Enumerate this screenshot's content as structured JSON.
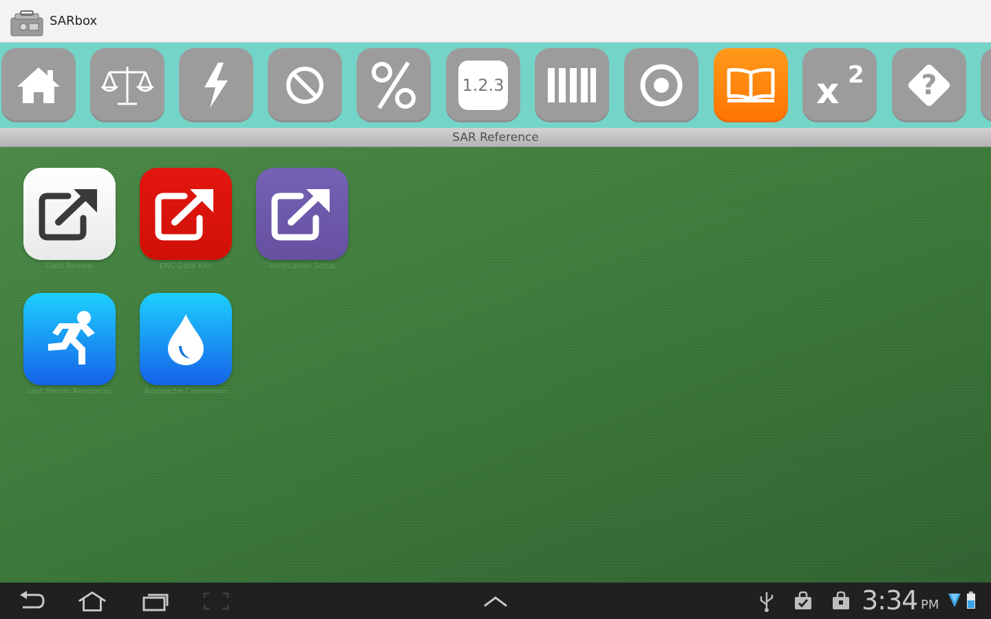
{
  "app": {
    "title": "SARbox",
    "logo_icon": "toolbox-icon"
  },
  "toolbar": {
    "items": [
      {
        "name": "home",
        "icon": "home-icon",
        "active": false
      },
      {
        "name": "balance",
        "icon": "balance-scale-icon",
        "active": false
      },
      {
        "name": "lightning",
        "icon": "lightning-icon",
        "active": false
      },
      {
        "name": "prohibited",
        "icon": "no-symbol-icon",
        "active": false
      },
      {
        "name": "percent",
        "icon": "percent-icon",
        "active": false
      },
      {
        "name": "numbers",
        "icon": "numbers-icon",
        "label": "1.2.3",
        "active": false
      },
      {
        "name": "bars",
        "icon": "bars-icon",
        "active": false
      },
      {
        "name": "target",
        "icon": "target-icon",
        "active": false
      },
      {
        "name": "reference",
        "icon": "book-icon",
        "active": true
      },
      {
        "name": "exponent",
        "icon": "x-squared-icon",
        "label": "x",
        "sup": "2",
        "active": false
      },
      {
        "name": "help",
        "icon": "question-diamond-icon",
        "label": "?",
        "active": false
      }
    ],
    "colors": {
      "background": "#74d4c8",
      "button": "#9c9c9c",
      "active": "#ff8a0d"
    }
  },
  "section": {
    "title": "SAR Reference"
  },
  "apps": [
    {
      "label": "Data Review",
      "icon": "external-link-icon",
      "color": "#ffffff"
    },
    {
      "label": "ENC Data Kits",
      "icon": "external-link-icon",
      "color": "#d8140e"
    },
    {
      "label": "Verification Setup",
      "icon": "external-link-icon",
      "color": "#6d57a8"
    },
    {
      "label": "Lost Person Resources",
      "icon": "running-person-icon",
      "color": "#1e8cf0"
    },
    {
      "label": "Avalanche Conversion",
      "icon": "water-drop-icon",
      "color": "#1e8cf0"
    }
  ],
  "statusbar": {
    "time": "3:34",
    "ampm": "PM",
    "icons": [
      "usb-icon",
      "shopping-bag-check-icon",
      "shopping-bag-icon",
      "wifi-icon",
      "battery-icon"
    ]
  },
  "navbar": {
    "icons": [
      "back-icon",
      "home-nav-icon",
      "recent-apps-icon",
      "screenshot-icon",
      "chevron-up-icon"
    ]
  }
}
